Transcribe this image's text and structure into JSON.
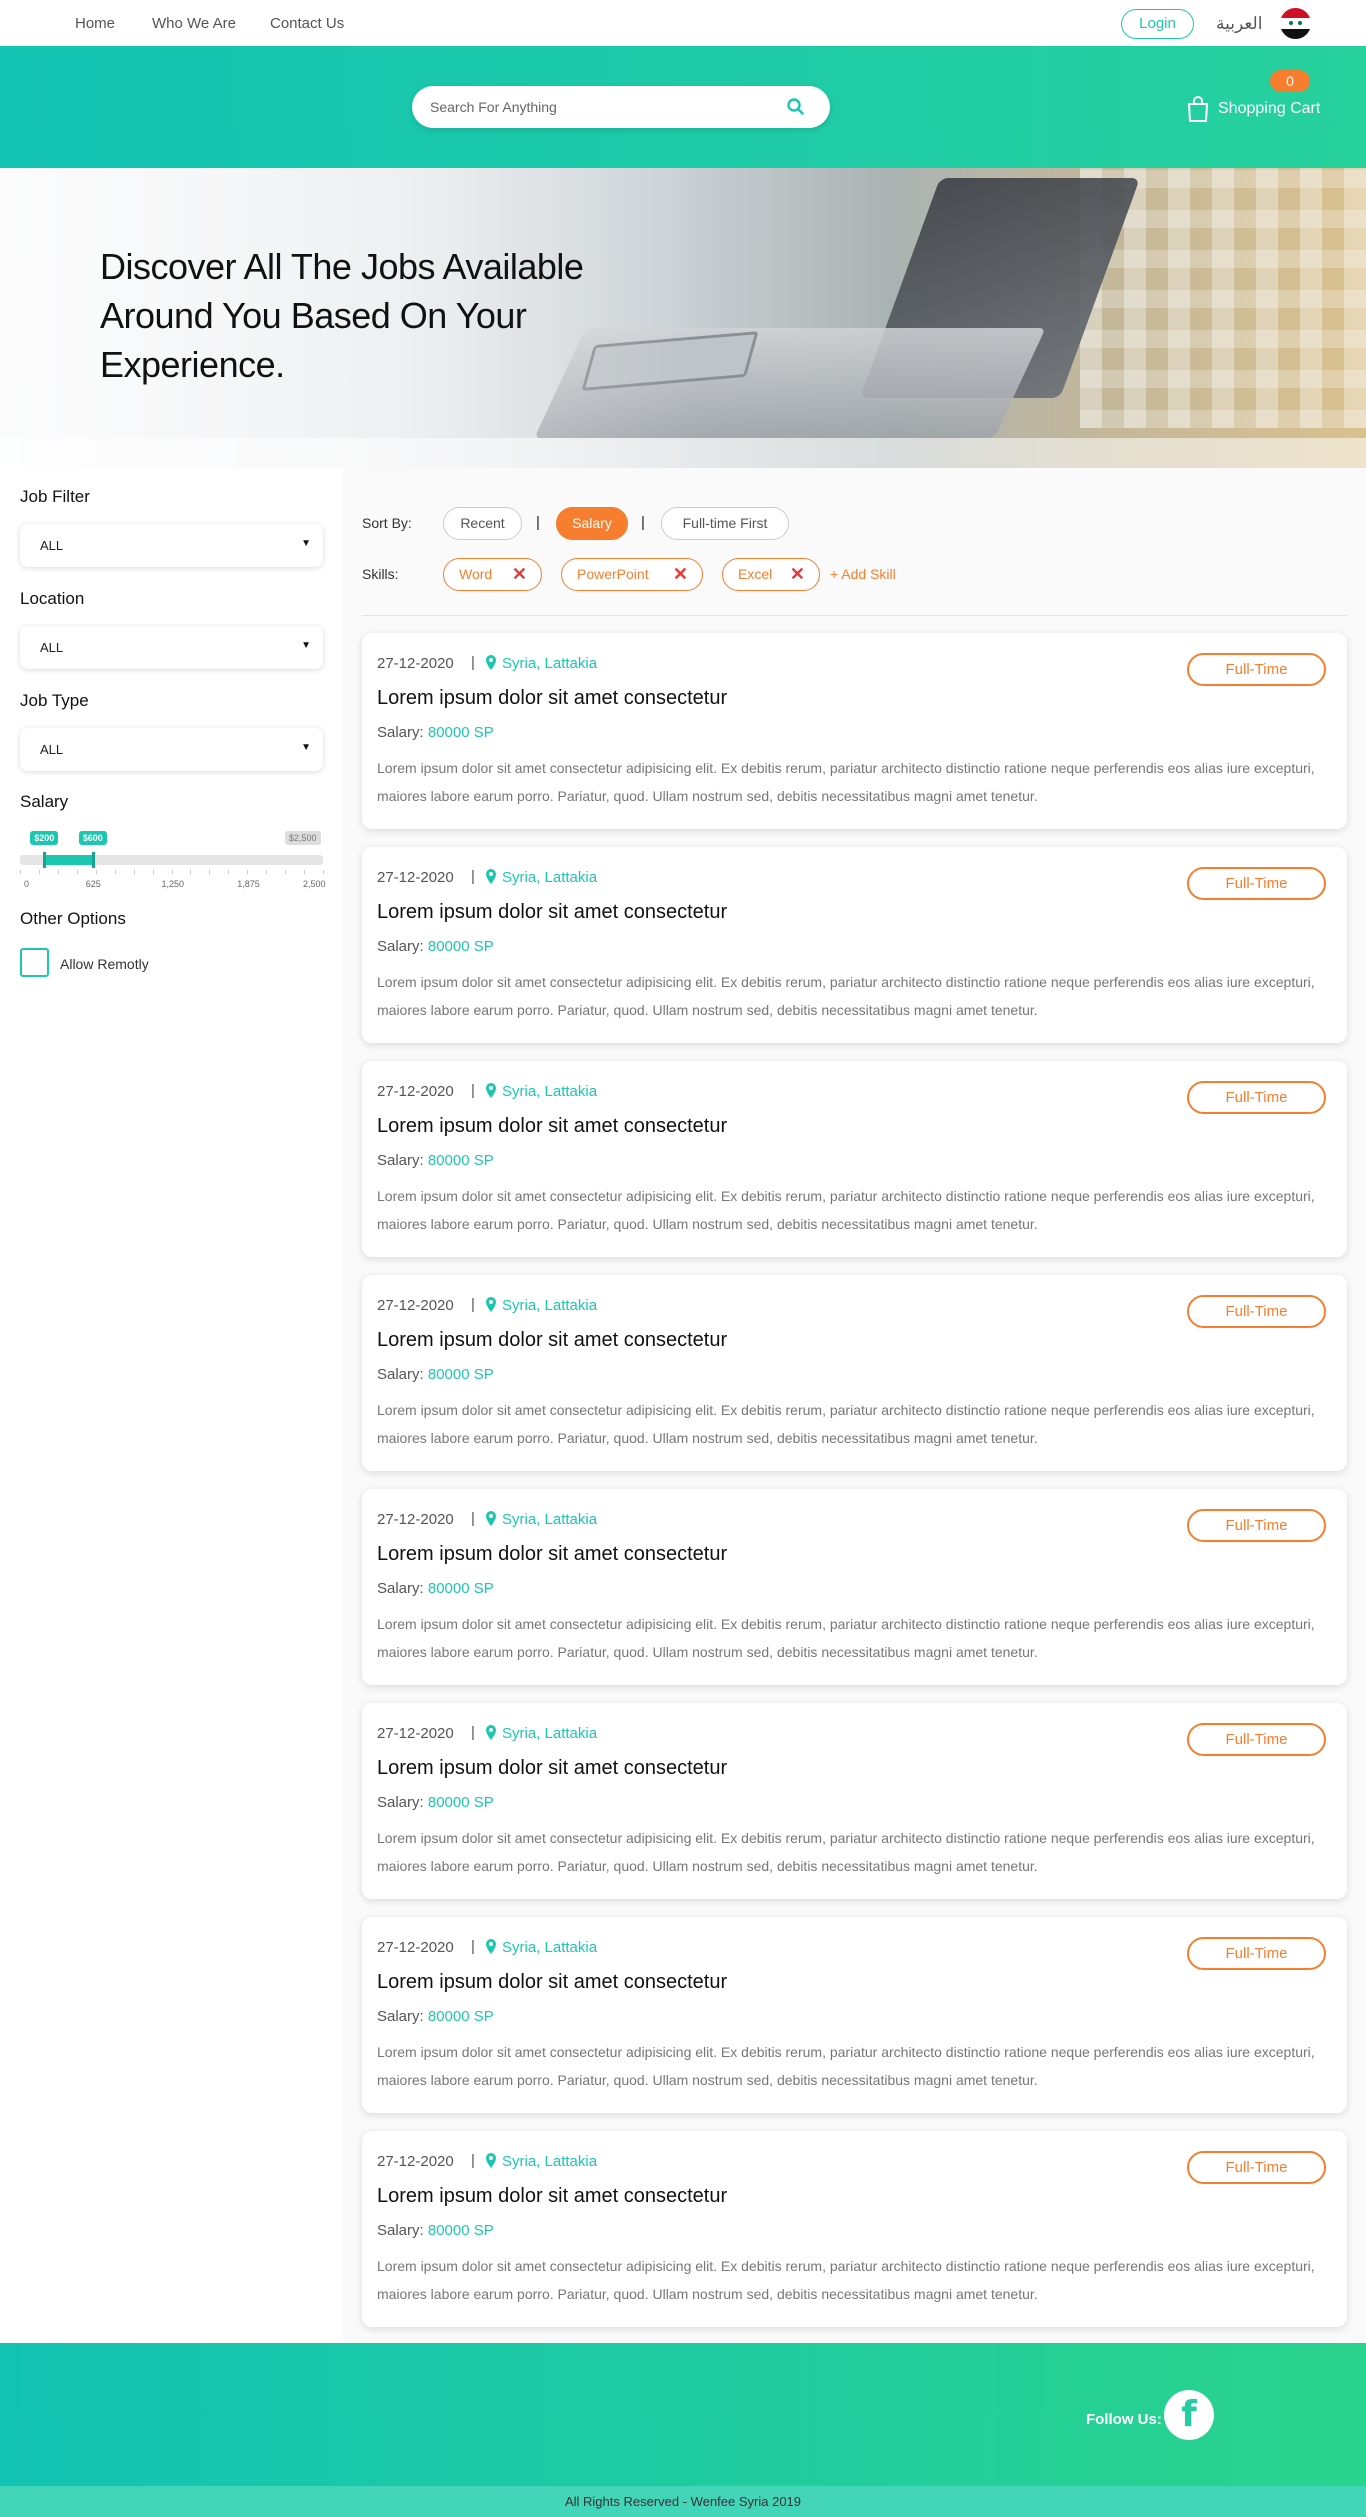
{
  "nav": {
    "links": [
      "Home",
      "Who We Are",
      "Contact Us"
    ],
    "login": "Login",
    "language": "العربية"
  },
  "header": {
    "search_placeholder": "Search For Anything",
    "cart_label": "Shopping Cart",
    "cart_count": "0"
  },
  "hero": {
    "title": "Discover All The Jobs Available Around You Based On Your Experience."
  },
  "filters": {
    "job_filter": {
      "label": "Job Filter",
      "value": "ALL"
    },
    "location": {
      "label": "Location",
      "value": "ALL"
    },
    "job_type": {
      "label": "Job Type",
      "value": "ALL"
    },
    "salary": {
      "label": "Salary",
      "min_tag": "$200",
      "max_tag": "$600",
      "range_max_tag": "$2,500",
      "ticks": [
        "0",
        "625",
        "1,250",
        "1,875",
        "2,500"
      ],
      "range_min": 0,
      "range_max": 2500,
      "selected_min": 200,
      "selected_max": 600
    },
    "other_options": {
      "label": "Other Options",
      "checkbox_label": "Allow Remotly",
      "checked": false
    }
  },
  "sort": {
    "label": "Sort By:",
    "options": [
      "Recent",
      "Salary",
      "Full-time First"
    ],
    "active": "Salary"
  },
  "skills": {
    "label": "Skills:",
    "items": [
      "Word",
      "PowerPoint",
      "Excel"
    ],
    "add_label": "+ Add Skill"
  },
  "jobs": [
    {
      "date": "27-12-2020",
      "location": "Syria, Lattakia",
      "title": "Lorem ipsum dolor sit amet consectetur",
      "salary_label": "Salary:",
      "salary": "80000 SP",
      "description": "Lorem ipsum dolor sit amet consectetur adipisicing elit. Ex debitis rerum, pariatur architecto distinctio ratione neque perferendis eos alias iure excepturi, maiores labore earum porro. Pariatur, quod. Ullam nostrum sed, debitis necessitatibus magni amet tenetur.",
      "type": "Full-Time"
    },
    {
      "date": "27-12-2020",
      "location": "Syria, Lattakia",
      "title": "Lorem ipsum dolor sit amet consectetur",
      "salary_label": "Salary:",
      "salary": "80000 SP",
      "description": "Lorem ipsum dolor sit amet consectetur adipisicing elit. Ex debitis rerum, pariatur architecto distinctio ratione neque perferendis eos alias iure excepturi, maiores labore earum porro. Pariatur, quod. Ullam nostrum sed, debitis necessitatibus magni amet tenetur.",
      "type": "Full-Time"
    },
    {
      "date": "27-12-2020",
      "location": "Syria, Lattakia",
      "title": "Lorem ipsum dolor sit amet consectetur",
      "salary_label": "Salary:",
      "salary": "80000 SP",
      "description": "Lorem ipsum dolor sit amet consectetur adipisicing elit. Ex debitis rerum, pariatur architecto distinctio ratione neque perferendis eos alias iure excepturi, maiores labore earum porro. Pariatur, quod. Ullam nostrum sed, debitis necessitatibus magni amet tenetur.",
      "type": "Full-Time"
    },
    {
      "date": "27-12-2020",
      "location": "Syria, Lattakia",
      "title": "Lorem ipsum dolor sit amet consectetur",
      "salary_label": "Salary:",
      "salary": "80000 SP",
      "description": "Lorem ipsum dolor sit amet consectetur adipisicing elit. Ex debitis rerum, pariatur architecto distinctio ratione neque perferendis eos alias iure excepturi, maiores labore earum porro. Pariatur, quod. Ullam nostrum sed, debitis necessitatibus magni amet tenetur.",
      "type": "Full-Time"
    },
    {
      "date": "27-12-2020",
      "location": "Syria, Lattakia",
      "title": "Lorem ipsum dolor sit amet consectetur",
      "salary_label": "Salary:",
      "salary": "80000 SP",
      "description": "Lorem ipsum dolor sit amet consectetur adipisicing elit. Ex debitis rerum, pariatur architecto distinctio ratione neque perferendis eos alias iure excepturi, maiores labore earum porro. Pariatur, quod. Ullam nostrum sed, debitis necessitatibus magni amet tenetur.",
      "type": "Full-Time"
    },
    {
      "date": "27-12-2020",
      "location": "Syria, Lattakia",
      "title": "Lorem ipsum dolor sit amet consectetur",
      "salary_label": "Salary:",
      "salary": "80000 SP",
      "description": "Lorem ipsum dolor sit amet consectetur adipisicing elit. Ex debitis rerum, pariatur architecto distinctio ratione neque perferendis eos alias iure excepturi, maiores labore earum porro. Pariatur, quod. Ullam nostrum sed, debitis necessitatibus magni amet tenetur.",
      "type": "Full-Time"
    },
    {
      "date": "27-12-2020",
      "location": "Syria, Lattakia",
      "title": "Lorem ipsum dolor sit amet consectetur",
      "salary_label": "Salary:",
      "salary": "80000 SP",
      "description": "Lorem ipsum dolor sit amet consectetur adipisicing elit. Ex debitis rerum, pariatur architecto distinctio ratione neque perferendis eos alias iure excepturi, maiores labore earum porro. Pariatur, quod. Ullam nostrum sed, debitis necessitatibus magni amet tenetur.",
      "type": "Full-Time"
    },
    {
      "date": "27-12-2020",
      "location": "Syria, Lattakia",
      "title": "Lorem ipsum dolor sit amet consectetur",
      "salary_label": "Salary:",
      "salary": "80000 SP",
      "description": "Lorem ipsum dolor sit amet consectetur adipisicing elit. Ex debitis rerum, pariatur architecto distinctio ratione neque perferendis eos alias iure excepturi, maiores labore earum porro. Pariatur, quod. Ullam nostrum sed, debitis necessitatibus magni amet tenetur.",
      "type": "Full-Time"
    }
  ],
  "footer": {
    "follow_label": "Follow Us:",
    "facebook_icon": "f",
    "copyright": "All Rights Reserved - Wenfee Syria 2019"
  },
  "colors": {
    "primary": "#1cc7af",
    "accent": "#f67e2e",
    "header_gradient_start": "#13c3b3",
    "header_gradient_end": "#26d19c"
  },
  "icons": [
    "search-icon",
    "shopping-bag-icon",
    "map-pin-icon",
    "close-icon",
    "facebook-icon",
    "syria-flag-icon",
    "dropdown-arrow-icon"
  ]
}
